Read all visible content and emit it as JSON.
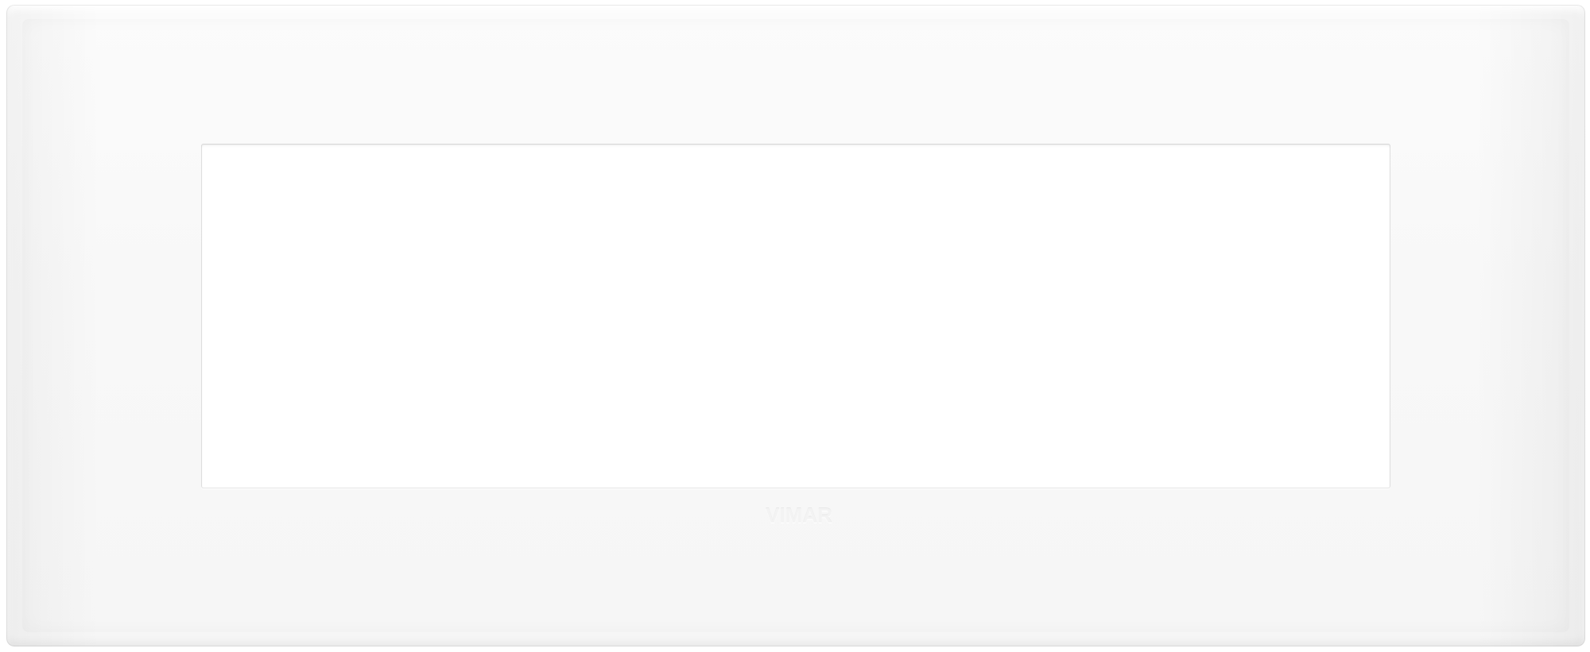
{
  "product": {
    "brand_logo_text": "VIMAR"
  },
  "colors": {
    "plate": "#f8f8f8",
    "window": "#ffffff",
    "logo": "#f3f3f3"
  }
}
